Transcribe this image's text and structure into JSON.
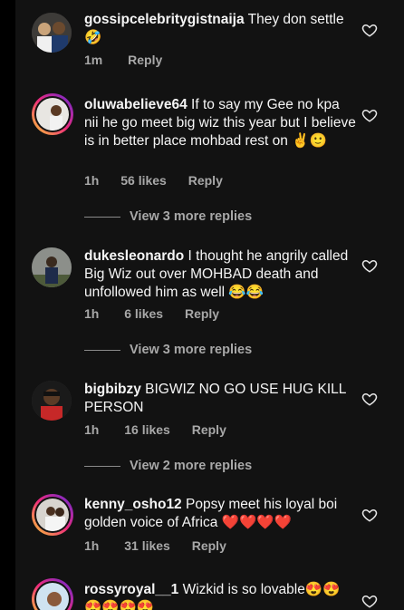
{
  "comments": [
    {
      "username": "gossipcelebritygistnaija",
      "text": " They don settle 🤣",
      "time": "1m",
      "likes": "",
      "reply": "Reply"
    },
    {
      "username": "oluwabelieve64",
      "text": " If to say my Gee no kpa nii he go meet big wiz this year but I believe is in better place mohbad rest on ✌️🙂",
      "time": "1h",
      "likes": "56 likes",
      "reply": "Reply",
      "more": "View 3 more replies"
    },
    {
      "username": "dukesleonardo",
      "text": " I thought he angrily called Big Wiz out over MOHBAD death and unfollowed him as well 😂😂",
      "time": "1h",
      "likes": "6 likes",
      "reply": "Reply",
      "more": "View 3 more replies"
    },
    {
      "username": "bigbibzy",
      "text": " BIGWIZ NO GO USE HUG KILL PERSON",
      "time": "1h",
      "likes": "16 likes",
      "reply": "Reply",
      "more": "View 2 more replies"
    },
    {
      "username": "kenny_osho12",
      "text": " Popsy meet his loyal boi golden voice of Africa ❤️❤️❤️❤️",
      "time": "1h",
      "likes": "31 likes",
      "reply": "Reply"
    },
    {
      "username": "rossyroyal__1",
      "text": " Wizkid is so lovable😍😍😍😍😍😍"
    }
  ],
  "colors": {
    "background": "#121212",
    "muted": "#a8a8a8",
    "text": "#f5f5f5"
  },
  "icons": {
    "like": "heart-outline-icon"
  }
}
